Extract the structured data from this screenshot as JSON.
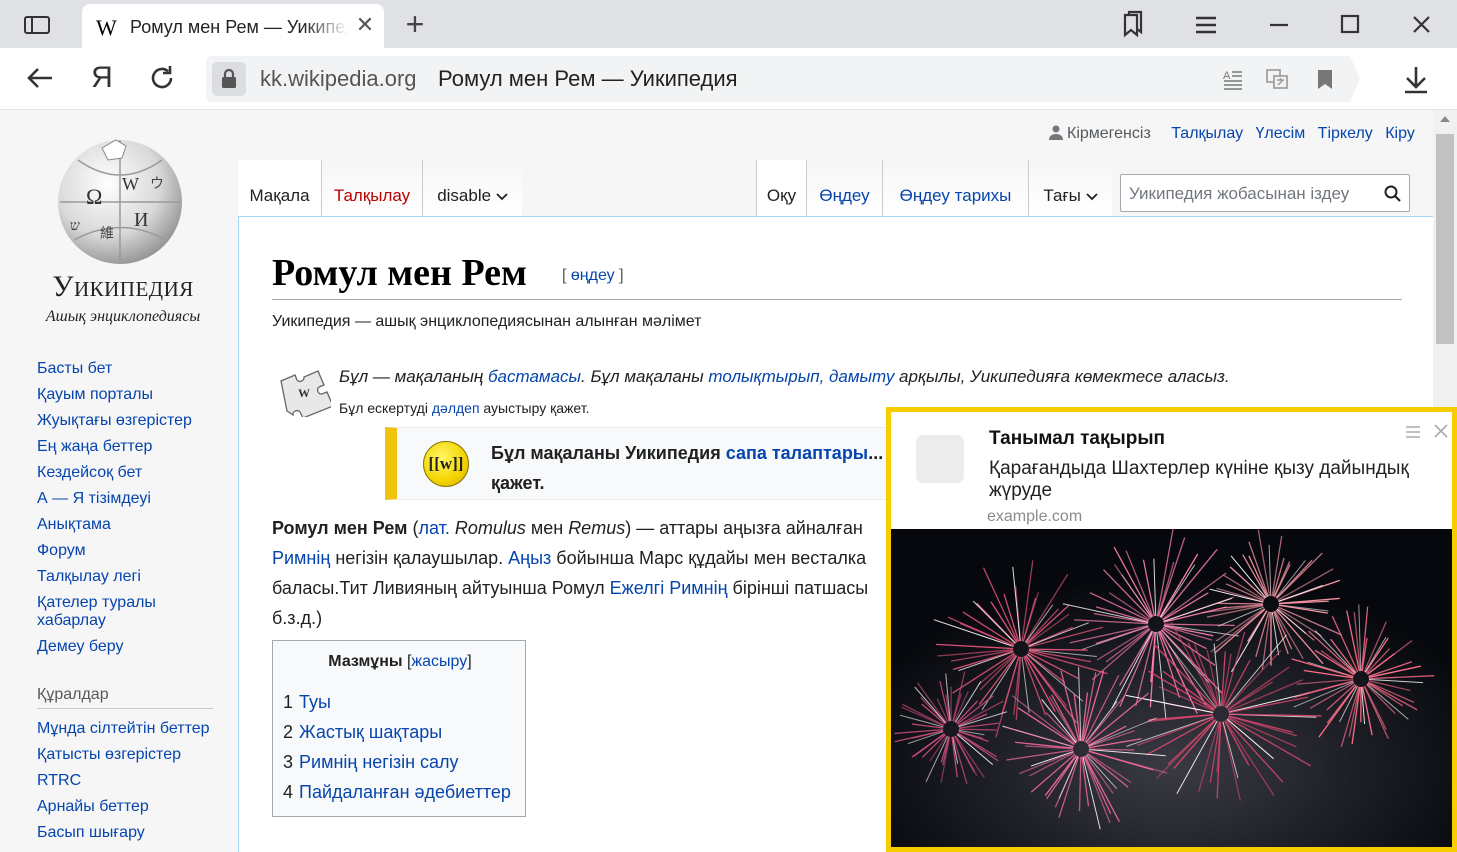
{
  "browser": {
    "tab_favicon": "W",
    "tab_title": "Ромул мен Рем — Уикипедия",
    "tab_close_glyph": "✕",
    "new_tab_glyph": "+",
    "yandex_logo": "Я",
    "address_domain": "kk.wikipedia.org",
    "address_title": "Ромул мен Рем — Уикипедия",
    "icons": [
      "sidebar-icon",
      "collections-icon",
      "menu-icon",
      "minimize-icon",
      "maximize-icon",
      "close-icon",
      "back-icon",
      "reload-icon",
      "lock-icon",
      "reader-icon",
      "translate-icon",
      "bookmark-icon",
      "download-icon"
    ]
  },
  "wiki": {
    "logo": {
      "wordmark": "Уикипедия",
      "tagline": "Ашық энциклопедиясы"
    },
    "personal": {
      "anon": "Кірмегенсіз",
      "talk": "Талқылау",
      "contrib": "Үлесім",
      "create": "Тіркелу",
      "login": "Кіру"
    },
    "tabs": {
      "article": "Мақала",
      "talk": "Талқылау",
      "variant": "disable",
      "read": "Оқу",
      "edit": "Өңдеу",
      "history": "Өңдеу тарихы",
      "more": "Тағы"
    },
    "search_placeholder": "Уикипедия жобасынан іздеу",
    "nav": [
      "Басты бет",
      "Қауым порталы",
      "Жуықтағы өзгерістер",
      "Ең жаңа беттер",
      "Кездейсоқ бет",
      "А — Я тізімдеуі",
      "Анықтама",
      "Форум",
      "Талқылау легі",
      "Қателер туралы хабарлау",
      "Демеу беру"
    ],
    "tools_heading": "Құралдар",
    "tools": [
      "Мұнда сілтейтін беттер",
      "Қатысты өзгерістер",
      "RTRC",
      "Арнайы беттер",
      "Басып шығару"
    ],
    "article": {
      "title": "Ромул мен Рем",
      "edit_link": "өңдеу",
      "tagline": "Уикипедия — ашық энциклопедиясынан алынған мәлімет",
      "stub": {
        "part1": "Бұл — мақаланың ",
        "link1": "бастамасы",
        "part2": ". Бұл мақаланы ",
        "link2": "толықтырып, дамыту",
        "part3": " арқылы, Уикипедияға көмектесе аласыз.",
        "note_before": "Бұл ескертуді ",
        "note_link": "дәлдеп",
        "note_after": " ауыстыру қажет."
      },
      "quality": {
        "icon_text": "[[w]]",
        "part1": "Бұл мақаланы Уикипедия ",
        "link": "сапа талаптары",
        "part2": "...",
        "line2": "қажет."
      },
      "para": {
        "bold": "Ромул мен Рем",
        "open": " (",
        "lat": "лат.",
        "romulus": " Romulus",
        "and": " мен ",
        "remus": "Remus",
        "text1": ") — аттары аңызға айналған",
        "rim": "Римнің",
        "text2": " негізін қалаушылар. ",
        "anyz": "Аңыз",
        "text3": " бойынша Марс құдайы мен весталка",
        "text4": "баласы.Тит Ливияның айтуынша Ромул ",
        "ejelgi": "Ежелгі Римнің",
        "text5": " бірінші патшасы",
        "text6": "б.з.д.)"
      },
      "toc": {
        "title": "Мазмұны",
        "toggle": "жасыру",
        "items": [
          {
            "num": "1",
            "label": "Туы"
          },
          {
            "num": "2",
            "label": "Жастық шақтары"
          },
          {
            "num": "3",
            "label": "Римнің негізін салу"
          },
          {
            "num": "4",
            "label": "Пайдаланған әдебиеттер"
          }
        ]
      }
    }
  },
  "popup": {
    "title": "Танымал тақырып",
    "body": "Қарағандыда Шахтерлер күніне қызу дайындық жүруде",
    "source": "example.com",
    "image_alt": "fireworks",
    "border_color": "#f7cd00"
  }
}
